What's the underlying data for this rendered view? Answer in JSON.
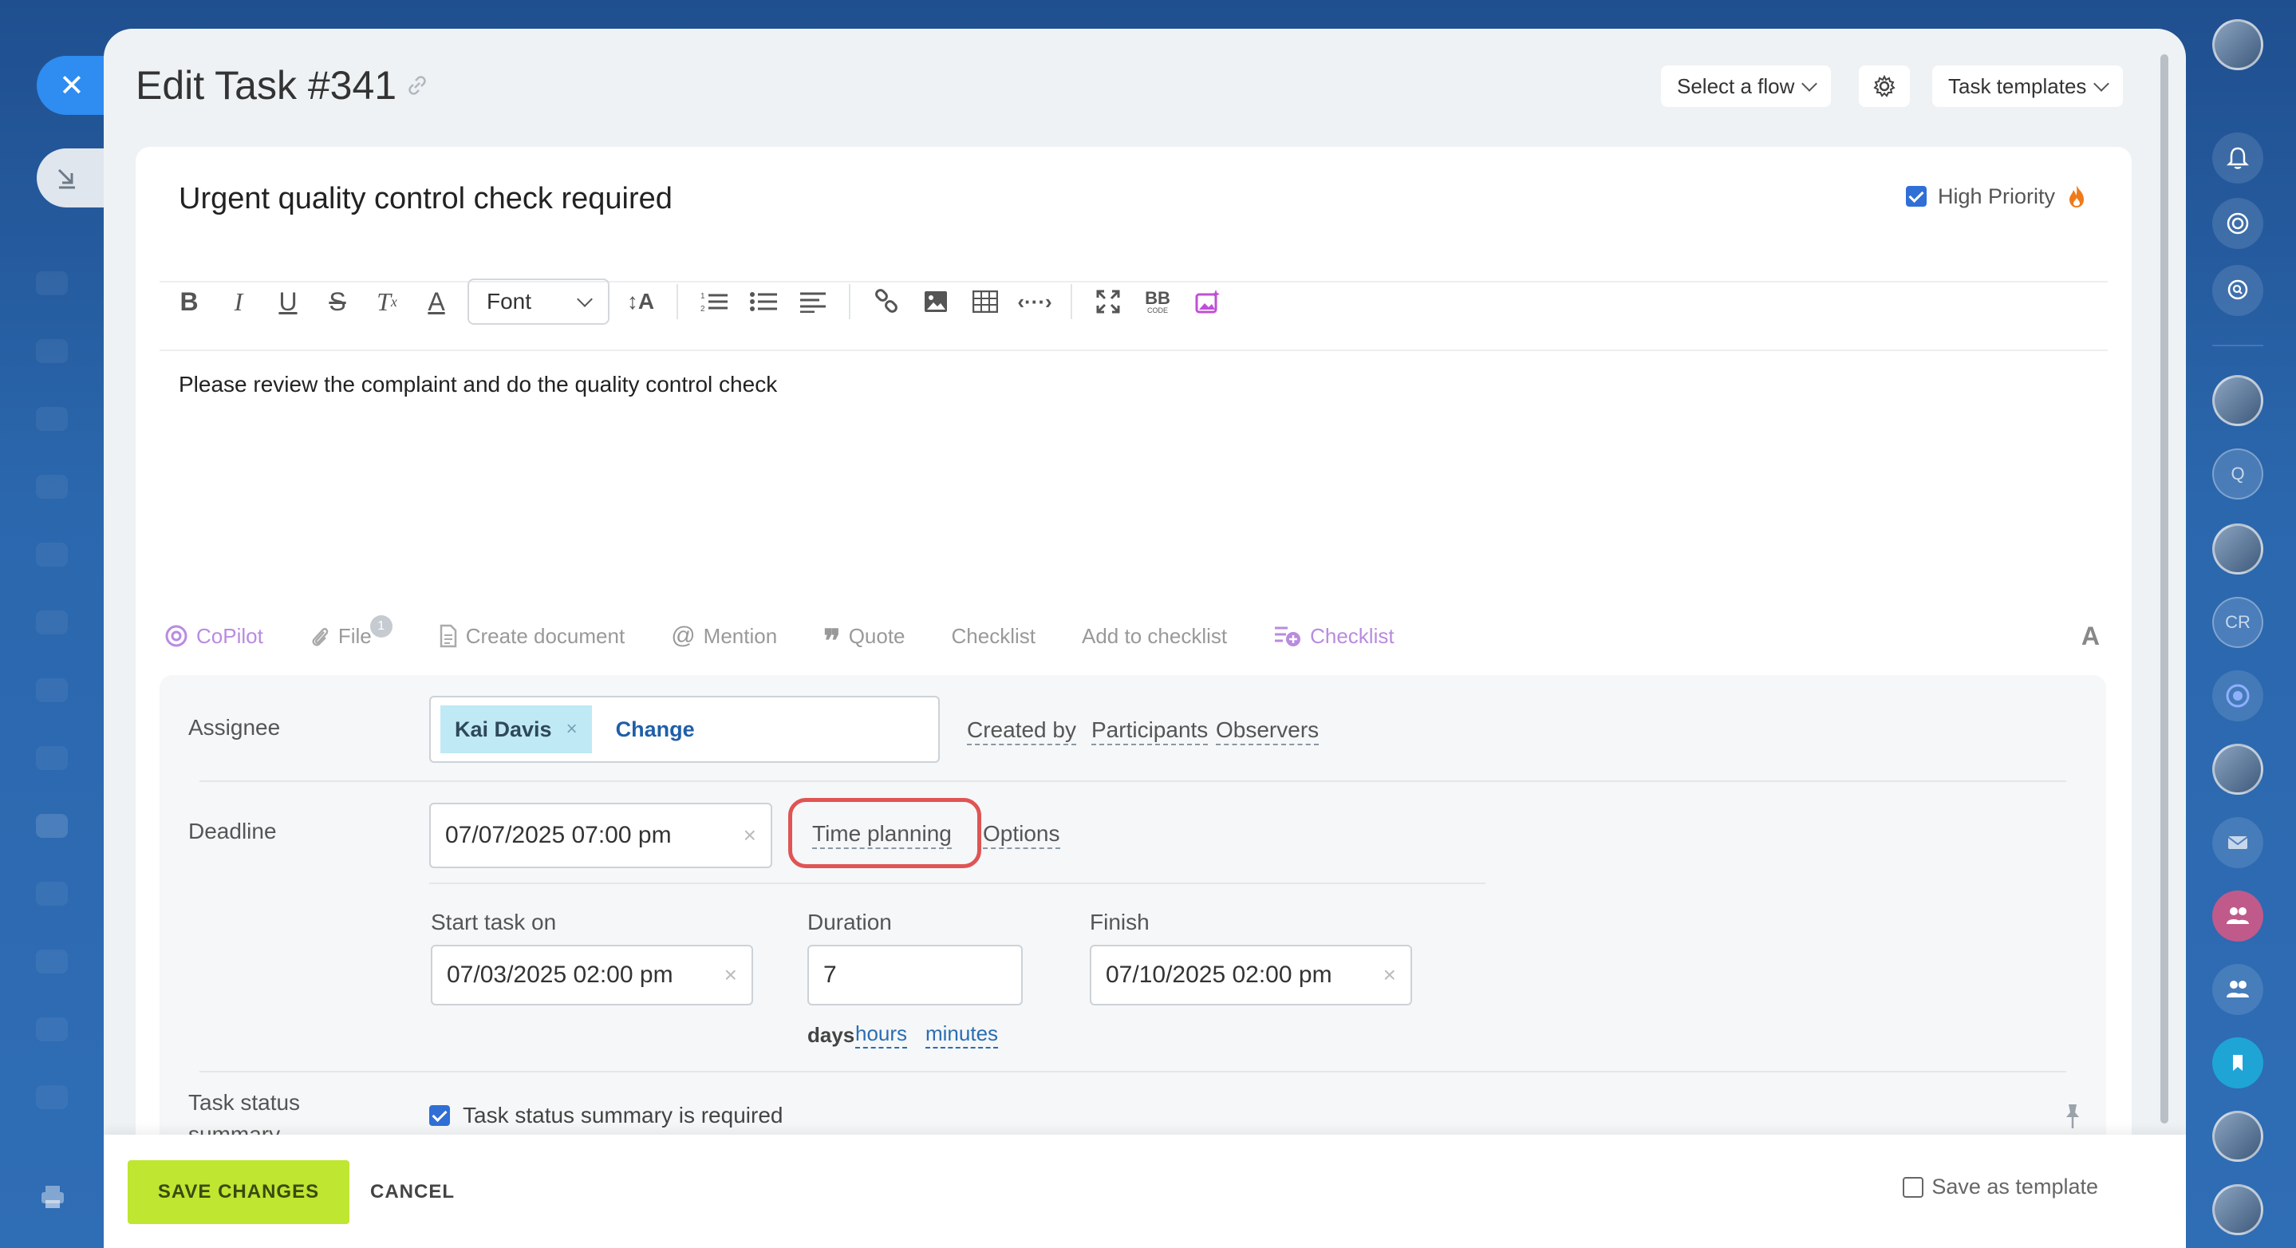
{
  "panel": {
    "title": "Edit Task #341",
    "flow_select": "Select a flow",
    "templates_select": "Task templates"
  },
  "task": {
    "title": "Urgent quality control check required",
    "high_priority_label": "High Priority",
    "high_priority_checked": true,
    "description": "Please review the complaint and do the quality control check"
  },
  "editor": {
    "font_select": "Font",
    "bbcode_label": "BB",
    "bbcode_sub": "CODE"
  },
  "actions": {
    "copilot": "CoPilot",
    "file": "File",
    "file_count": "1",
    "create_document": "Create document",
    "mention": "Mention",
    "quote": "Quote",
    "checklist_text": "Checklist",
    "add_to_checklist": "Add to checklist",
    "checklist_new": "Checklist",
    "font_toggle": "A"
  },
  "form": {
    "assignee_label": "Assignee",
    "assignee_name": "Kai Davis",
    "assignee_remove": "×",
    "change": "Change",
    "created_by": "Created by",
    "participants": "Participants",
    "observers": "Observers",
    "deadline_label": "Deadline",
    "deadline_value": "07/07/2025 07:00 pm",
    "time_planning": "Time planning",
    "options": "Options",
    "start_label": "Start task on",
    "start_value": "07/03/2025 02:00 pm",
    "duration_label": "Duration",
    "duration_value": "7",
    "finish_label": "Finish",
    "finish_value": "07/10/2025 02:00 pm",
    "unit_days": "days",
    "unit_hours": "hours",
    "unit_minutes": "minutes",
    "status_label_1": "Task status",
    "status_label_2": "summary",
    "status_checkbox": "Task status summary is required",
    "clear_symbol": "×"
  },
  "footer": {
    "save": "SAVE CHANGES",
    "cancel": "CANCEL",
    "save_template": "Save as template"
  },
  "right_rail": {
    "initials_q": "Q",
    "initials_cr": "CR"
  },
  "colors": {
    "accent_blue": "#2f8cf0",
    "save_green": "#bfe630",
    "highlight_red": "#e05454",
    "chip_bg": "#bfe9f5",
    "checklist_purple": "#b98be0"
  }
}
